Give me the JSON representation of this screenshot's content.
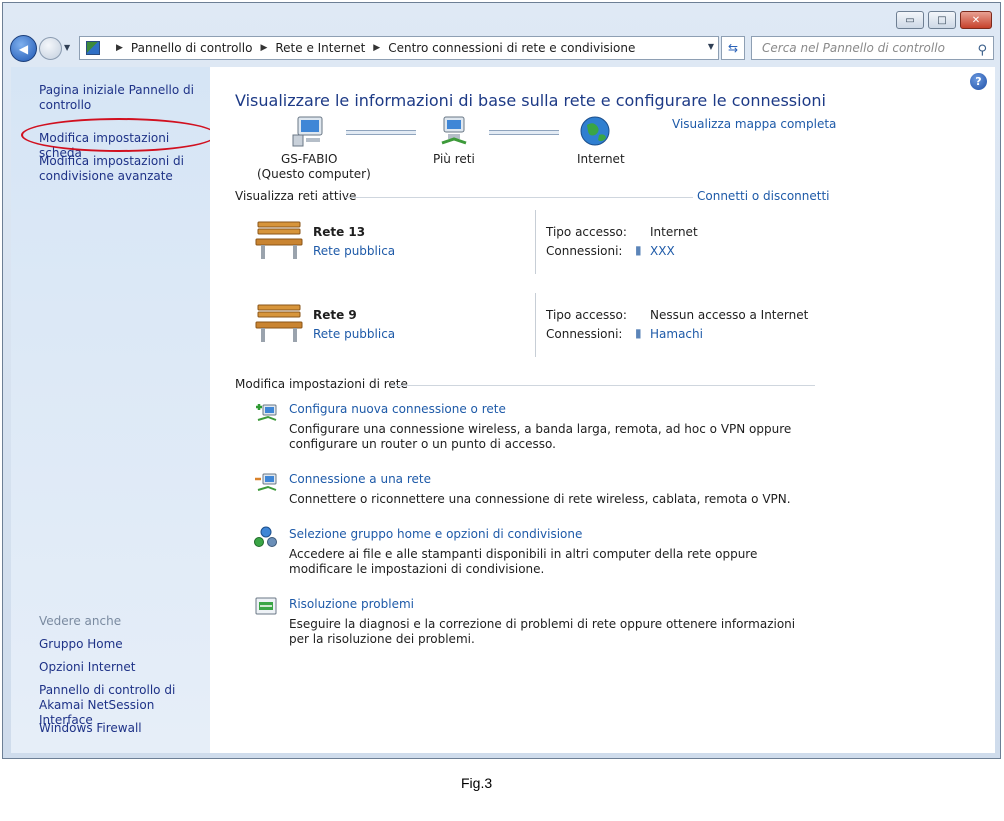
{
  "window": {
    "controls": {
      "minimize": "▭",
      "maximize": "□",
      "close": "✕"
    }
  },
  "navbar": {
    "back_glyph": "◀",
    "breadcrumbs": [
      "Pannello di controllo",
      "Rete e Internet",
      "Centro connessioni di rete e condivisione"
    ],
    "search_placeholder": "Cerca nel Pannello di controllo"
  },
  "sidebar": {
    "home_link": "Pagina iniziale Pannello di controllo",
    "adapter_link": "Modifica impostazioni scheda",
    "sharing_link": "Modifica impostazioni di condivisione avanzate",
    "see_also_header": "Vedere anche",
    "see_also": [
      "Gruppo Home",
      "Opzioni Internet",
      "Pannello di controllo di Akamai NetSession Interface",
      "Windows Firewall"
    ]
  },
  "main": {
    "title": "Visualizzare le informazioni di base sulla rete e configurare le connessioni",
    "full_map_link": "Visualizza mappa completa",
    "map": {
      "computer_name": "GS-FABIO",
      "computer_sub": "(Questo computer)",
      "networks_label": "Più reti",
      "internet_label": "Internet"
    },
    "active_networks_header": "Visualizza reti attive",
    "connect_link": "Connetti o disconnetti",
    "networks": [
      {
        "name": "Rete  13",
        "type": "Rete pubblica",
        "access_label": "Tipo accesso:",
        "access": "Internet",
        "conn_label": "Connessioni:",
        "conn": "XXX"
      },
      {
        "name": "Rete  9",
        "type": "Rete pubblica",
        "access_label": "Tipo accesso:",
        "access": "Nessun accesso a Internet",
        "conn_label": "Connessioni:",
        "conn": "Hamachi"
      }
    ],
    "settings_header": "Modifica impostazioni di rete",
    "tasks": [
      {
        "title": "Configura nuova connessione o rete",
        "desc": "Configurare una connessione wireless, a banda larga, remota, ad hoc o VPN oppure configurare un router o un punto di accesso."
      },
      {
        "title": "Connessione a una rete",
        "desc": "Connettere o riconnettere una connessione di rete wireless, cablata, remota o VPN."
      },
      {
        "title": "Selezione gruppo home e opzioni di condivisione",
        "desc": "Accedere ai file e alle stampanti disponibili in altri computer della rete oppure modificare le impostazioni di condivisione."
      },
      {
        "title": "Risoluzione problemi",
        "desc": "Eseguire la diagnosi e la correzione di problemi di rete oppure ottenere informazioni per la risoluzione dei problemi."
      }
    ]
  },
  "caption": "Fig.3",
  "colors": {
    "link": "#1e5aa8",
    "title": "#1d3a86",
    "highlight_oval": "#d1101f",
    "sidebar": "#d6e5f5"
  }
}
